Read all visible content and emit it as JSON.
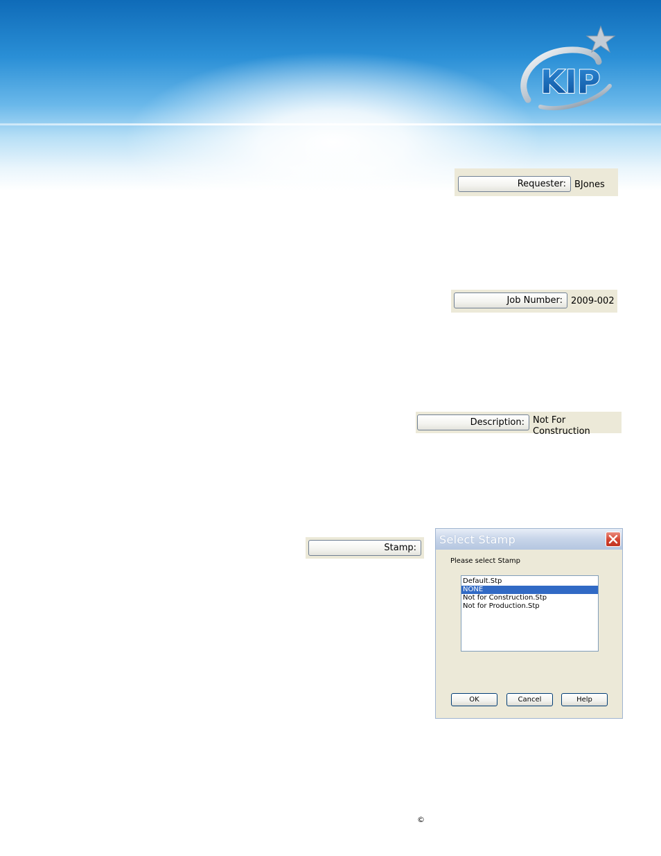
{
  "fields": {
    "requester": {
      "label": "Requester:",
      "value": "BJones"
    },
    "job_number": {
      "label": "Job Number:",
      "value": "2009-002"
    },
    "description": {
      "label": "Description:",
      "value": "Not For Construction"
    },
    "stamp": {
      "label": "Stamp:"
    }
  },
  "dialog": {
    "title": "Select Stamp",
    "prompt": "Please select Stamp",
    "items": [
      "Default.Stp",
      "NONE",
      "Not for Construction.Stp",
      "Not for Production.Stp"
    ],
    "selected_item": "NONE",
    "buttons": {
      "ok": "OK",
      "cancel": "Cancel",
      "help": "Help"
    }
  },
  "logo": {
    "text": "KIP"
  },
  "footer": {
    "copyright_symbol": "©"
  },
  "colors": {
    "header_blue": "#1a7cc6",
    "selection_blue": "#316ac5",
    "dialog_face": "#ece9d8",
    "close_red": "#d2432f"
  }
}
